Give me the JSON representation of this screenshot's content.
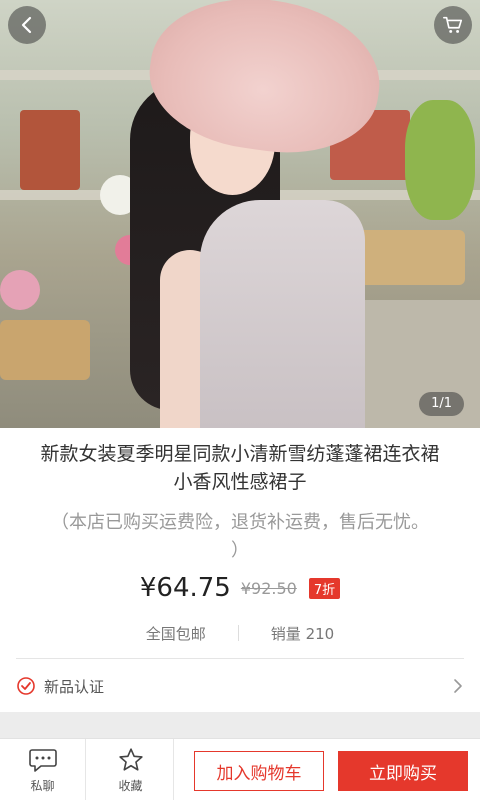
{
  "gallery": {
    "pager_text": "1/1"
  },
  "product": {
    "title_line1": "新款女装夏季明星同款小清新雪纺蓬蓬裙连衣裙",
    "title_line2": "小香风性感裙子",
    "subtitle_line1": "（本店已购买运费险，退货补运费，售后无忧。",
    "subtitle_line2": "）",
    "price": "¥64.75",
    "original_price": "¥92.50",
    "discount_badge": "7折",
    "shipping": "全国包邮",
    "sales": "销量 210",
    "certification": "新品认证"
  },
  "bottom_bar": {
    "chat_label": "私聊",
    "favorite_label": "收藏",
    "add_to_cart_label": "加入购物车",
    "buy_now_label": "立即购买"
  },
  "colors": {
    "accent": "#e5382c",
    "text": "#333333",
    "muted": "#999999"
  },
  "icons": [
    "back-icon",
    "cart-icon",
    "check-circle-icon",
    "chevron-right-icon",
    "chat-bubble-icon",
    "star-icon"
  ]
}
